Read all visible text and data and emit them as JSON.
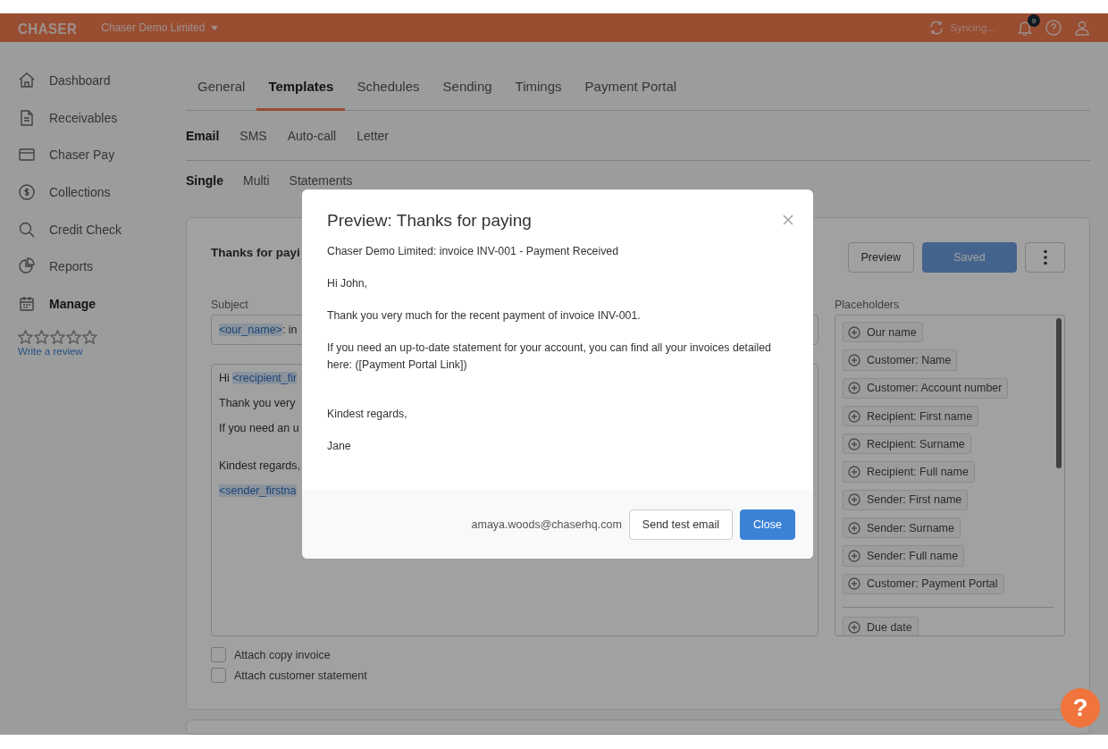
{
  "topbar": {
    "logo": "CHASER",
    "company": "Chaser Demo Limited",
    "sync_status": "Syncing...",
    "notification_count": "9"
  },
  "sidebar": {
    "items": [
      {
        "label": "Dashboard",
        "selected": false
      },
      {
        "label": "Receivables",
        "selected": false
      },
      {
        "label": "Chaser Pay",
        "selected": false
      },
      {
        "label": "Collections",
        "selected": false
      },
      {
        "label": "Credit Check",
        "selected": false
      },
      {
        "label": "Reports",
        "selected": false
      },
      {
        "label": "Manage",
        "selected": true
      }
    ],
    "stars": 0,
    "review_link": "Write a review"
  },
  "tabs": [
    {
      "label": "General",
      "selected": false
    },
    {
      "label": "Templates",
      "selected": true
    },
    {
      "label": "Schedules",
      "selected": false
    },
    {
      "label": "Sending",
      "selected": false
    },
    {
      "label": "Timings",
      "selected": false
    },
    {
      "label": "Payment Portal",
      "selected": false
    }
  ],
  "channel_tabs": [
    {
      "label": "Email",
      "selected": true
    },
    {
      "label": "SMS",
      "selected": false
    },
    {
      "label": "Auto-call",
      "selected": false
    },
    {
      "label": "Letter",
      "selected": false
    }
  ],
  "type_tabs": [
    {
      "label": "Single",
      "selected": true
    },
    {
      "label": "Multi",
      "selected": false
    },
    {
      "label": "Statements",
      "selected": false
    }
  ],
  "template": {
    "title": "Thanks for payi",
    "buttons": [
      {
        "label": "Preview",
        "kind": "outline"
      },
      {
        "label": "Saved",
        "kind": "primary",
        "disabled": true
      }
    ],
    "subject_label": "Subject",
    "subject": [
      {
        "kind": "tag",
        "text": "<our_name>"
      },
      {
        "kind": "text",
        "text": ": in"
      }
    ],
    "body_lines": [
      {
        "gap_before": false,
        "segments": [
          {
            "kind": "text",
            "text": "Hi "
          },
          {
            "kind": "tag",
            "text": "<recipient_fir"
          }
        ]
      },
      {
        "gap_before": false,
        "segments": [
          {
            "kind": "text",
            "text": "Thank you very"
          }
        ]
      },
      {
        "gap_before": false,
        "segments": [
          {
            "kind": "text",
            "text": "If you need an u"
          }
        ]
      },
      {
        "gap_before": true,
        "segments": [
          {
            "kind": "text",
            "text": "Kindest regards,"
          }
        ]
      },
      {
        "gap_before": false,
        "segments": [
          {
            "kind": "tag",
            "text": "<sender_firstna"
          }
        ]
      }
    ],
    "placeholders_label": "Placeholders",
    "placeholders": [
      {
        "label": "Our name"
      },
      {
        "label": "Customer: Name"
      },
      {
        "label": "Customer: Account number"
      },
      {
        "label": "Recipient: First name"
      },
      {
        "label": "Recipient: Surname"
      },
      {
        "label": "Recipient: Full name"
      },
      {
        "label": "Sender: First name"
      },
      {
        "label": "Sender: Surname"
      },
      {
        "label": "Sender: Full name"
      },
      {
        "label": "Customer: Payment Portal"
      },
      {
        "kind": "divider"
      },
      {
        "label": "Due date"
      }
    ],
    "attachments": [
      {
        "label": "Attach copy invoice",
        "checked": false
      },
      {
        "label": "Attach customer statement",
        "checked": false
      }
    ]
  },
  "modal": {
    "title": "Preview: Thanks for paying",
    "paragraphs": [
      "Chaser Demo Limited: invoice INV-001 - Payment Received",
      "Hi John,",
      "Thank you very much for the recent payment of  invoice INV-001.",
      "If you need an up-to-date statement for your account, you can find all your invoices detailed here:  ([Payment Portal Link])",
      "Kindest regards,",
      "Jane"
    ],
    "sender_email": "amaya.woods@chaserhq.com",
    "buttons": [
      {
        "label": "Send test email",
        "kind": "outline"
      },
      {
        "label": "Close",
        "kind": "primary"
      }
    ]
  },
  "help_button": "?"
}
